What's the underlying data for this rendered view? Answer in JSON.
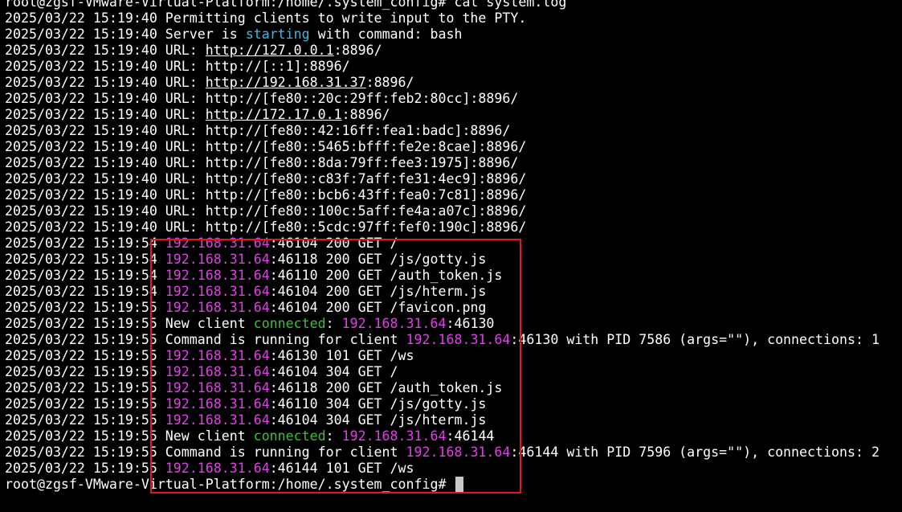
{
  "colors": {
    "background": "#000000",
    "text": "#ffffff",
    "ip_address": "#e040e8",
    "starting_keyword": "#3fb6e8",
    "connected_keyword": "#35c438",
    "highlight_box": "#e11b1b",
    "cursor": "#c8c8c8"
  },
  "terminal": {
    "lines": [
      [
        {
          "t": "root@zgsf-VMware-Virtual-Platform:/home/.system_config# cat system.log"
        }
      ],
      [
        {
          "t": "2025/03/22 15:19:40 Permitting clients to write input to the PTY."
        }
      ],
      [
        {
          "t": "2025/03/22 15:19:40 Server is "
        },
        {
          "t": "starting",
          "c": "starting_keyword"
        },
        {
          "t": " with command: bash"
        }
      ],
      [
        {
          "t": "2025/03/22 15:19:40 URL: "
        },
        {
          "t": "http://127.0.0.1",
          "u": true
        },
        {
          "t": ":8896/"
        }
      ],
      [
        {
          "t": "2025/03/22 15:19:40 URL: http://[::1]:8896/"
        }
      ],
      [
        {
          "t": "2025/03/22 15:19:40 URL: "
        },
        {
          "t": "http://192.168.31.37",
          "u": true
        },
        {
          "t": ":8896/"
        }
      ],
      [
        {
          "t": "2025/03/22 15:19:40 URL: http://[fe80::20c:29ff:feb2:80cc]:8896/"
        }
      ],
      [
        {
          "t": "2025/03/22 15:19:40 URL: "
        },
        {
          "t": "http://172.17.0.1",
          "u": true
        },
        {
          "t": ":8896/"
        }
      ],
      [
        {
          "t": "2025/03/22 15:19:40 URL: http://[fe80::42:16ff:fea1:badc]:8896/"
        }
      ],
      [
        {
          "t": "2025/03/22 15:19:40 URL: http://[fe80::5465:bfff:fe2e:8cae]:8896/"
        }
      ],
      [
        {
          "t": "2025/03/22 15:19:40 URL: http://[fe80::8da:79ff:fee3:1975]:8896/"
        }
      ],
      [
        {
          "t": "2025/03/22 15:19:40 URL: http://[fe80::c83f:7aff:fe31:4ec9]:8896/"
        }
      ],
      [
        {
          "t": "2025/03/22 15:19:40 URL: http://[fe80::bcb6:43ff:fea0:7c81]:8896/"
        }
      ],
      [
        {
          "t": "2025/03/22 15:19:40 URL: http://[fe80::100c:5aff:fe4a:a07c]:8896/"
        }
      ],
      [
        {
          "t": "2025/03/22 15:19:40 URL: http://[fe80::5cdc:97ff:fef0:190c]:8896/"
        }
      ],
      [
        {
          "t": "2025/03/22 15:19:54 "
        },
        {
          "t": "192.168.31.64",
          "c": "ip_address"
        },
        {
          "t": ":46104 200 GET /"
        }
      ],
      [
        {
          "t": "2025/03/22 15:19:54 "
        },
        {
          "t": "192.168.31.64",
          "c": "ip_address"
        },
        {
          "t": ":46118 200 GET /js/gotty.js"
        }
      ],
      [
        {
          "t": "2025/03/22 15:19:54 "
        },
        {
          "t": "192.168.31.64",
          "c": "ip_address"
        },
        {
          "t": ":46110 200 GET /auth_token.js"
        }
      ],
      [
        {
          "t": "2025/03/22 15:19:54 "
        },
        {
          "t": "192.168.31.64",
          "c": "ip_address"
        },
        {
          "t": ":46104 200 GET /js/hterm.js"
        }
      ],
      [
        {
          "t": "2025/03/22 15:19:55 "
        },
        {
          "t": "192.168.31.64",
          "c": "ip_address"
        },
        {
          "t": ":46104 200 GET /favicon.png"
        }
      ],
      [
        {
          "t": "2025/03/22 15:19:55 New client "
        },
        {
          "t": "connected",
          "c": "connected_keyword"
        },
        {
          "t": ": "
        },
        {
          "t": "192.168.31.64",
          "c": "ip_address"
        },
        {
          "t": ":46130"
        }
      ],
      [
        {
          "t": "2025/03/22 15:19:55 Command is running for client "
        },
        {
          "t": "192.168.31.64",
          "c": "ip_address"
        },
        {
          "t": ":46130 with PID 7586 (args=\"\"), connections: 1"
        }
      ],
      [
        {
          "t": "2025/03/22 15:19:55 "
        },
        {
          "t": "192.168.31.64",
          "c": "ip_address"
        },
        {
          "t": ":46130 101 GET /ws"
        }
      ],
      [
        {
          "t": "2025/03/22 15:19:55 "
        },
        {
          "t": "192.168.31.64",
          "c": "ip_address"
        },
        {
          "t": ":46104 304 GET /"
        }
      ],
      [
        {
          "t": "2025/03/22 15:19:55 "
        },
        {
          "t": "192.168.31.64",
          "c": "ip_address"
        },
        {
          "t": ":46118 200 GET /auth_token.js"
        }
      ],
      [
        {
          "t": "2025/03/22 15:19:55 "
        },
        {
          "t": "192.168.31.64",
          "c": "ip_address"
        },
        {
          "t": ":46110 304 GET /js/gotty.js"
        }
      ],
      [
        {
          "t": "2025/03/22 15:19:55 "
        },
        {
          "t": "192.168.31.64",
          "c": "ip_address"
        },
        {
          "t": ":46104 304 GET /js/hterm.js"
        }
      ],
      [
        {
          "t": "2025/03/22 15:19:55 New client "
        },
        {
          "t": "connected",
          "c": "connected_keyword"
        },
        {
          "t": ": "
        },
        {
          "t": "192.168.31.64",
          "c": "ip_address"
        },
        {
          "t": ":46144"
        }
      ],
      [
        {
          "t": "2025/03/22 15:19:55 Command is running for client "
        },
        {
          "t": "192.168.31.64",
          "c": "ip_address"
        },
        {
          "t": ":46144 with PID 7596 (args=\"\"), connections: 2"
        }
      ],
      [
        {
          "t": "2025/03/22 15:19:55 "
        },
        {
          "t": "192.168.31.64",
          "c": "ip_address"
        },
        {
          "t": ":46144 101 GET /ws"
        }
      ],
      [
        {
          "t": "root@zgsf-VMware-Virtual-Platform:/home/.system_config# "
        }
      ]
    ]
  }
}
